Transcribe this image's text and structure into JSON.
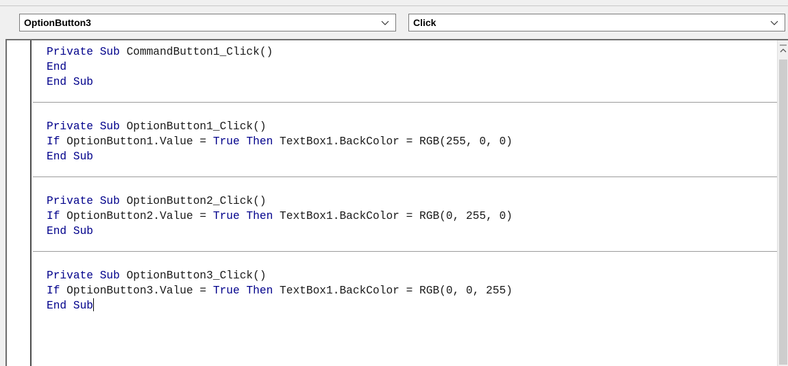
{
  "object_combo": {
    "value": "OptionButton3"
  },
  "procedure_combo": {
    "value": "Click"
  },
  "code": [
    {
      "lines": [
        [
          {
            "t": "Private Sub",
            "kw": true
          },
          {
            "t": " CommandButton1_Click()",
            "kw": false
          }
        ],
        [
          {
            "t": "End",
            "kw": true
          }
        ],
        [
          {
            "t": "End Sub",
            "kw": true
          }
        ]
      ]
    },
    {
      "lines": [
        [
          {
            "t": "Private Sub",
            "kw": true
          },
          {
            "t": " OptionButton1_Click()",
            "kw": false
          }
        ],
        [
          {
            "t": "If",
            "kw": true
          },
          {
            "t": " OptionButton1.Value = ",
            "kw": false
          },
          {
            "t": "True Then",
            "kw": true
          },
          {
            "t": " TextBox1.BackColor = RGB(255, 0, 0)",
            "kw": false
          }
        ],
        [
          {
            "t": "End Sub",
            "kw": true
          }
        ]
      ]
    },
    {
      "lines": [
        [
          {
            "t": "Private Sub",
            "kw": true
          },
          {
            "t": " OptionButton2_Click()",
            "kw": false
          }
        ],
        [
          {
            "t": "If",
            "kw": true
          },
          {
            "t": " OptionButton2.Value = ",
            "kw": false
          },
          {
            "t": "True Then",
            "kw": true
          },
          {
            "t": " TextBox1.BackColor = RGB(0, 255, 0)",
            "kw": false
          }
        ],
        [
          {
            "t": "End Sub",
            "kw": true
          }
        ]
      ]
    },
    {
      "lines": [
        [
          {
            "t": "Private Sub",
            "kw": true
          },
          {
            "t": " OptionButton3_Click()",
            "kw": false
          }
        ],
        [
          {
            "t": "If",
            "kw": true
          },
          {
            "t": " OptionButton3.Value = ",
            "kw": false
          },
          {
            "t": "True Then",
            "kw": true
          },
          {
            "t": " TextBox1.BackColor = RGB(0, 0, 255)",
            "kw": false
          }
        ],
        [
          {
            "t": "End Sub",
            "kw": true
          }
        ]
      ]
    }
  ],
  "colors": {
    "keyword": "#00008b",
    "identifier": "#1a1a1a",
    "separator": "#9a9a9a"
  },
  "icons": {
    "combo_arrow": "chevron-down-icon",
    "scroll_up": "scroll-up-arrow-icon"
  }
}
